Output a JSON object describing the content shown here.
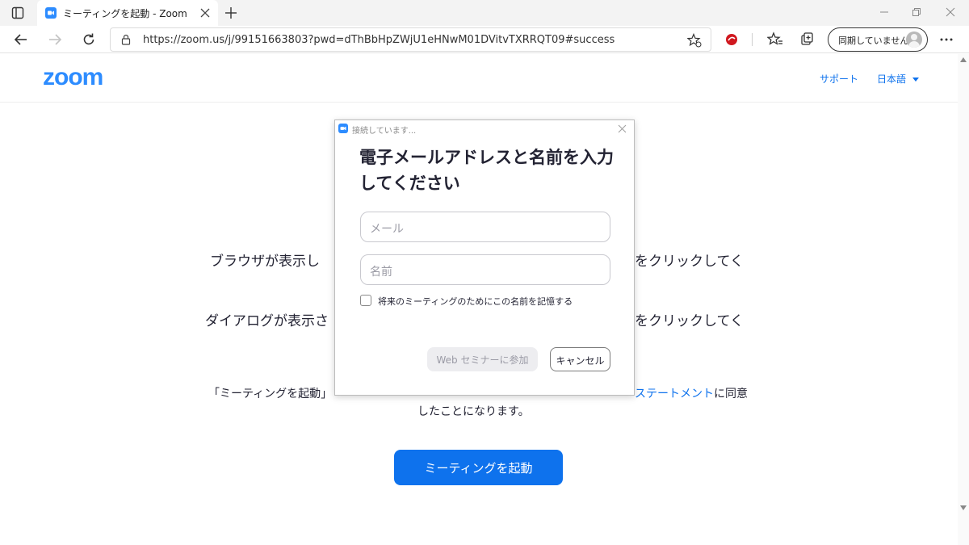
{
  "browser": {
    "tab_title": "ミーティングを起動 - Zoom",
    "url": "https://zoom.us/j/99151663803?pwd=dThBbHpZWjU1eHNwM01DVitvTXRRQT09#success",
    "sync_label": "同期していません"
  },
  "header": {
    "logo": "zoom",
    "support_link": "サポート",
    "language": "日本語"
  },
  "background": {
    "line1_left": "ブラウザが表示し",
    "line1_right": "をクリックしてく",
    "line2_left": "ダイアログが表示さ",
    "line2_right": "をクリックしてく",
    "agree_prefix": "「ミーティングを起動」",
    "agree_link": "ステートメント",
    "agree_suffix": "に同意",
    "agree_line2": "したことになります。",
    "launch_button": "ミーティングを起動"
  },
  "dialog": {
    "titlebar": "接続しています...",
    "heading": "電子メールアドレスと名前を入力してください",
    "email_placeholder": "メール",
    "name_placeholder": "名前",
    "remember_label": "将来のミーティングのためにこの名前を記憶する",
    "join_button": "Web セミナーに参加",
    "cancel_button": "キャンセル"
  },
  "colors": {
    "accent": "#0e72ed",
    "logo": "#2d8cff"
  }
}
